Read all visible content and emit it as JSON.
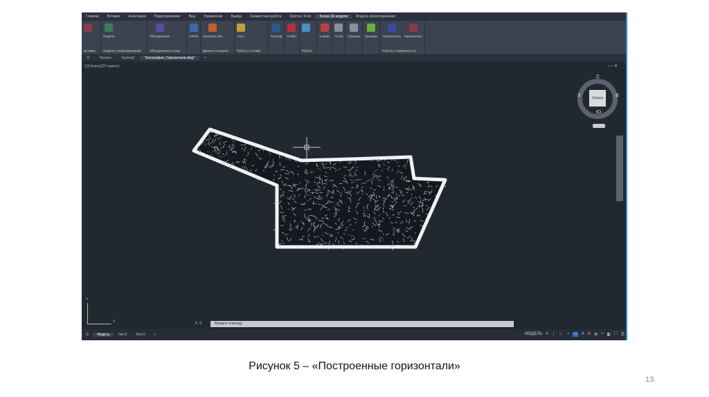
{
  "app": {
    "ribbon_tabs": [
      "Главная",
      "Вставка",
      "Аннотации",
      "Редактирование",
      "Вид",
      "Управление",
      "Вывод",
      "Совместная работа",
      "Express Tools",
      "Блоки 3D-модели",
      "Модуль проектирования"
    ],
    "active_ribbon_tab": 9,
    "panels": [
      {
        "label": "Вставка",
        "buttons": [
          ""
        ]
      },
      {
        "label": "Модели и моделирование",
        "buttons": [
          "Модель"
        ]
      },
      {
        "label": "Объединение и слои",
        "buttons": [
          "Объединение"
        ]
      },
      {
        "label": "",
        "buttons": [
          "СЛОИ"
        ]
      },
      {
        "label": "Данные и модели",
        "buttons": [
          "Просмотр 3D"
        ]
      },
      {
        "label": "Работа с сетями",
        "buttons": [
          "Сеть"
        ]
      },
      {
        "label": "",
        "buttons": [
          "Рельеф"
        ]
      },
      {
        "label": "",
        "buttons": [
          "Глобус"
        ]
      },
      {
        "label": "Работа",
        "buttons": [
          ""
        ]
      },
      {
        "label": "",
        "buttons": [
          "Анализ"
        ]
      },
      {
        "label": "",
        "buttons": [
          "Точка"
        ]
      },
      {
        "label": "",
        "buttons": [
          "Границы"
        ]
      },
      {
        "label": "",
        "buttons": [
          "Границы"
        ]
      },
      {
        "label": "Работа с поверхностью",
        "buttons": [
          "Поверхность",
          "Горизонтали"
        ]
      }
    ],
    "doc_tabs": [
      "Начало",
      "Чертеж1",
      "Топография_Горизонтали.dwg*"
    ],
    "active_doc_tab": 2,
    "viewport_label": "[-][Сверху][2D-каркас]",
    "viewcube": {
      "face": "Сверху",
      "north": "С",
      "south": "Ю",
      "west": "З",
      "east": "В"
    },
    "ucs": {
      "x": "X",
      "y": "Y"
    },
    "command_placeholder": "Введите команду",
    "layout_tabs": [
      "Модель",
      "Лист1",
      "Лист2"
    ],
    "active_layout_tab": 0,
    "status_text": "МОДЕЛЬ",
    "colors": {
      "canvas": "#212830",
      "ribbon": "#3b4350",
      "accent": "#2a8fd0"
    }
  },
  "caption": "Рисунок 5 – «Построенные горизонтали»",
  "page_number": "13"
}
